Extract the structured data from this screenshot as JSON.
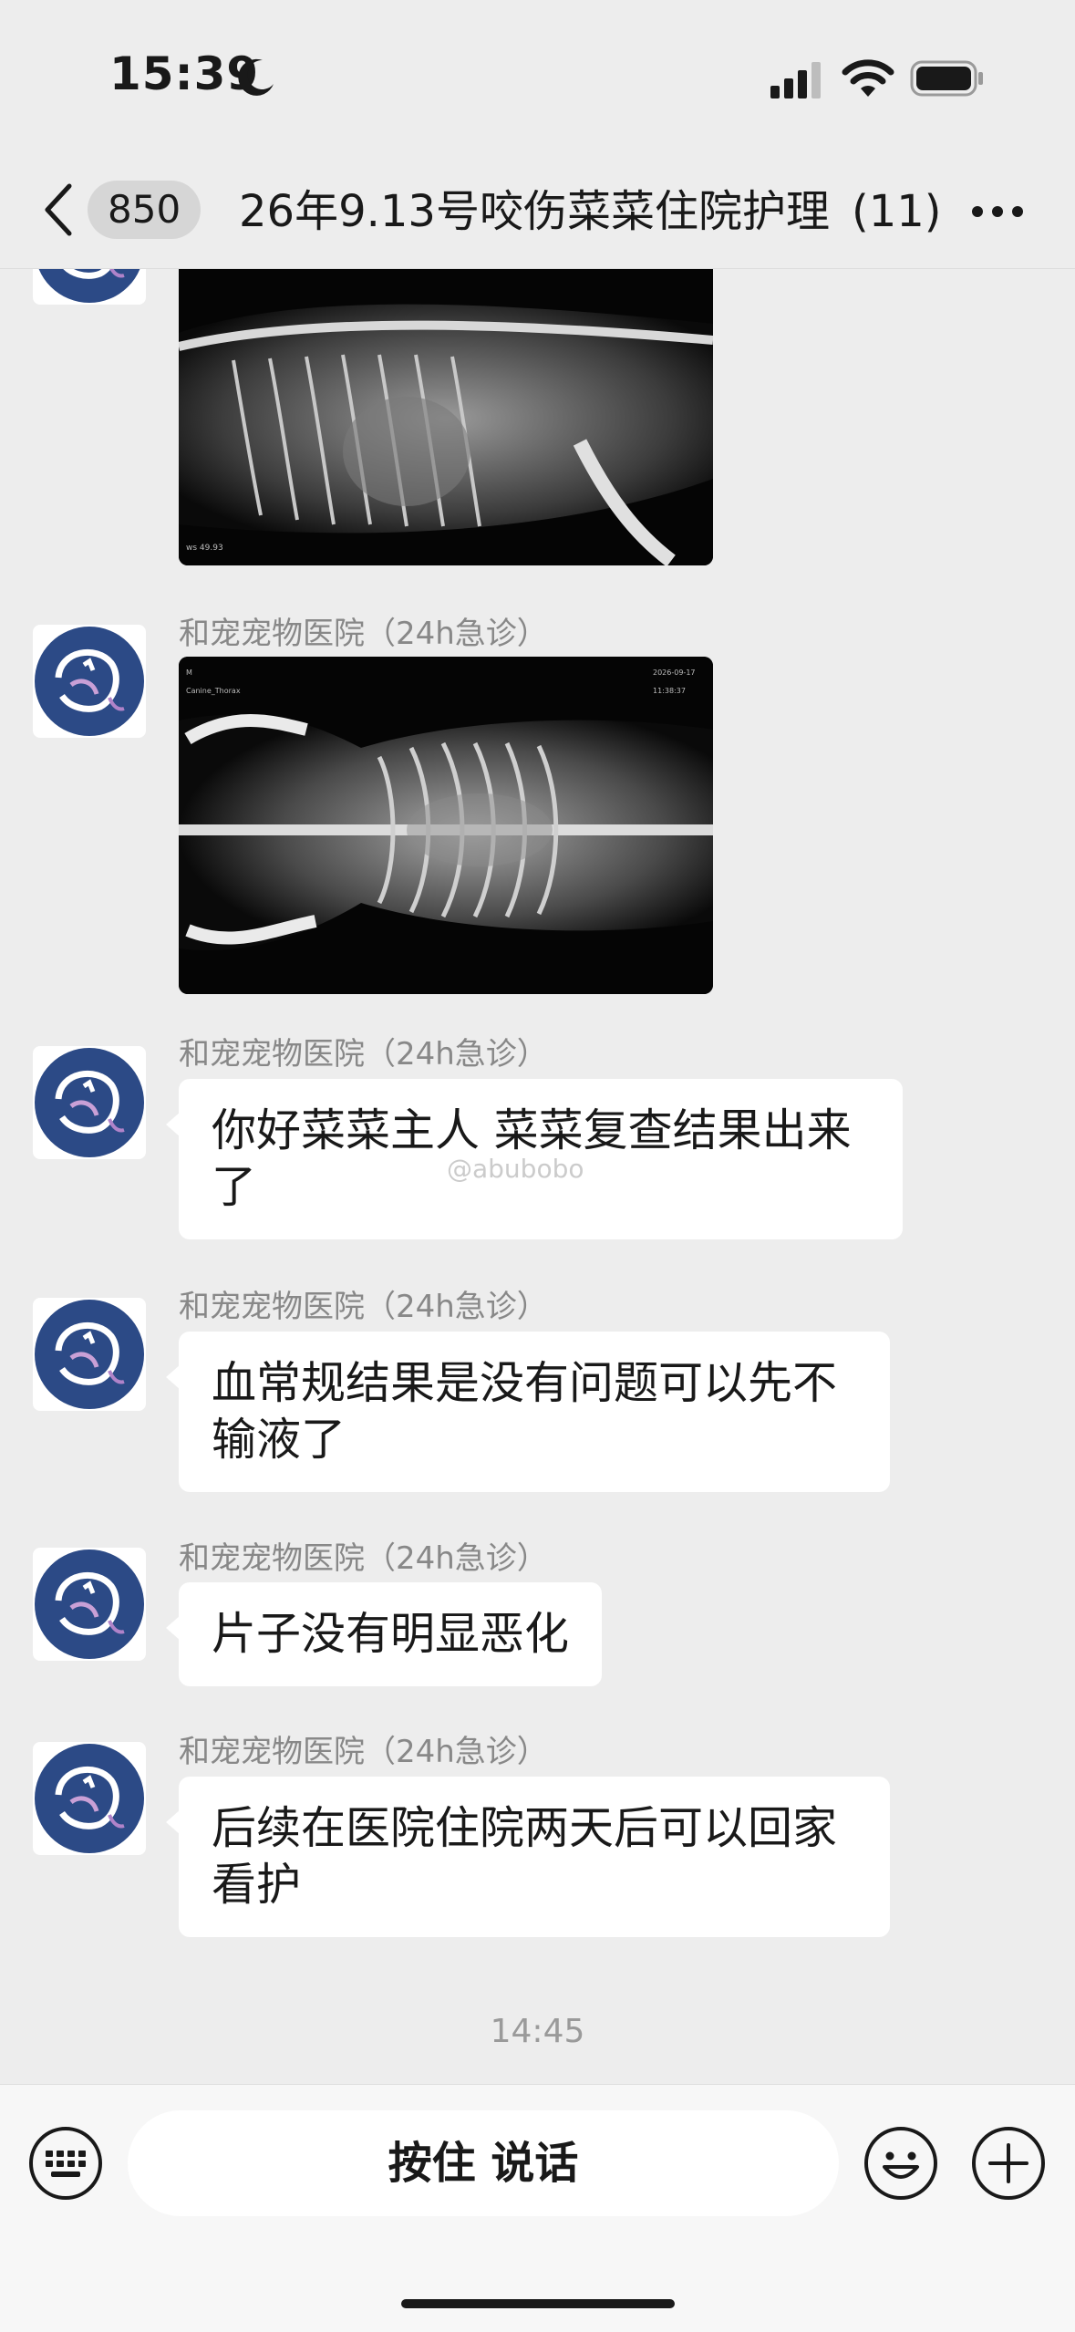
{
  "status": {
    "time": "15:39"
  },
  "nav": {
    "back_count": "850",
    "title": "26年9.13号咬伤菜菜住院护理",
    "member_count": "(11)"
  },
  "sender_name": "和宠宠物医院（24h急诊）",
  "messages": [
    {
      "type": "image",
      "content": "chest-xray-lateral"
    },
    {
      "type": "image",
      "content": "chest-xray-ventrodorsal"
    },
    {
      "type": "text",
      "text": "你好菜菜主人 菜菜复查结果出来了"
    },
    {
      "type": "text",
      "text": "血常规结果是没有问题可以先不输液了"
    },
    {
      "type": "text",
      "text": "片子没有明显恶化"
    },
    {
      "type": "text",
      "text": "后续在医院住院两天后可以回家看护"
    }
  ],
  "timestamp": "14:45",
  "watermark": "@abubobo",
  "input": {
    "voice_label": "按住 说话"
  },
  "icons": {
    "back": "chevron-left-icon",
    "more": "more-dots-icon",
    "keyboard": "keyboard-icon",
    "emoji": "emoji-icon",
    "plus": "plus-icon",
    "avatar": "hospital-logo-avatar"
  },
  "colors": {
    "background": "#ededed",
    "bubble": "#ffffff",
    "avatar_blue": "#2c4a86"
  }
}
